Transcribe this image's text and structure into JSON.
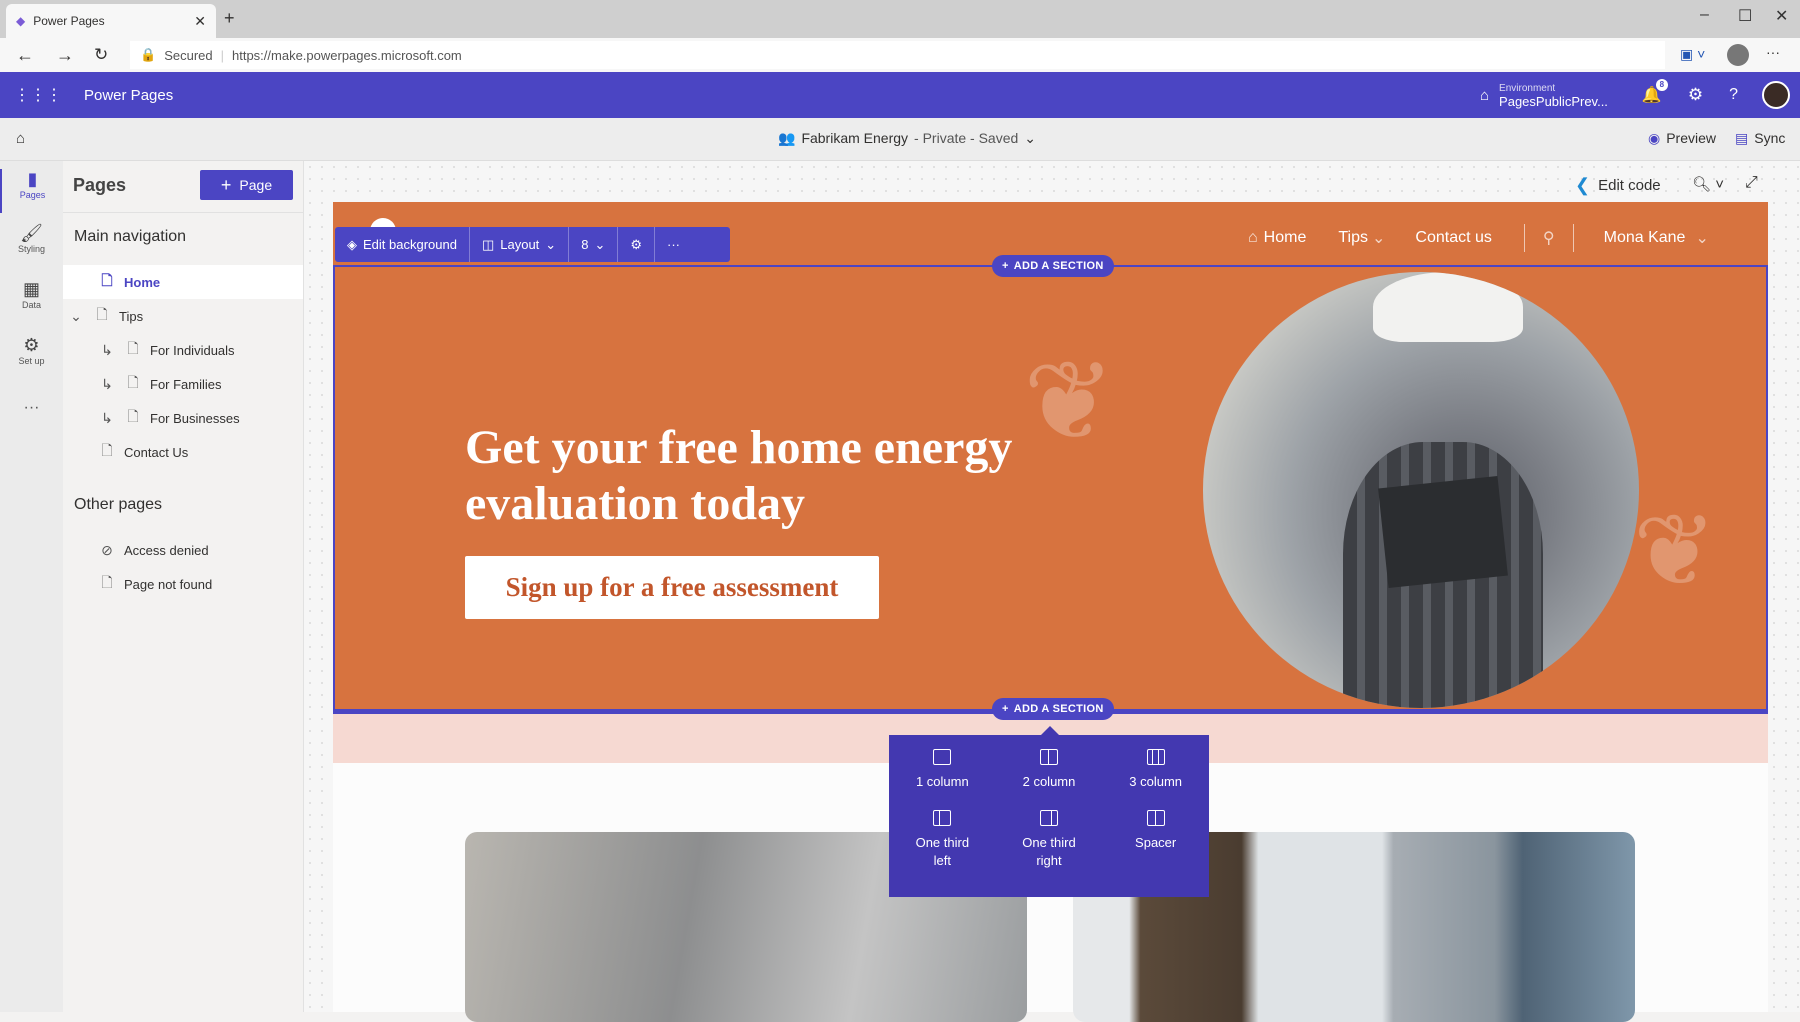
{
  "browser": {
    "tab_title": "Power Pages",
    "secured": "Secured",
    "url": "https://make.powerpages.microsoft.com"
  },
  "header": {
    "app_name": "Power Pages",
    "env_label": "Environment",
    "env_name": "PagesPublicPrev...",
    "notif_count": "8"
  },
  "cmdbar": {
    "site": "Fabrikam Energy",
    "status": " - Private - Saved",
    "preview": "Preview",
    "sync": "Sync"
  },
  "rail": [
    {
      "label": "Pages"
    },
    {
      "label": "Styling"
    },
    {
      "label": "Data"
    },
    {
      "label": "Set up"
    }
  ],
  "panel": {
    "title": "Pages",
    "add_page": "Page",
    "main_nav_title": "Main navigation",
    "main_nav": [
      {
        "label": "Home"
      },
      {
        "label": "Tips"
      },
      {
        "label": "For Individuals"
      },
      {
        "label": "For Families"
      },
      {
        "label": "For Businesses"
      },
      {
        "label": "Contact Us"
      }
    ],
    "other_title": "Other pages",
    "other": [
      {
        "label": "Access denied"
      },
      {
        "label": "Page not found"
      }
    ]
  },
  "canvas": {
    "edit_code": "Edit code",
    "toolbar": {
      "edit_background": "Edit background",
      "layout": "Layout"
    },
    "add_section": "ADD A SECTION",
    "site_nav": {
      "home": "Home",
      "tips": "Tips",
      "contact": "Contact us",
      "user": "Mona Kane"
    },
    "hero": {
      "heading": "Get your free home energy evaluation today",
      "cta": "Sign up for a free assessment"
    },
    "section_options": [
      {
        "label": "1 column"
      },
      {
        "label": "2 column"
      },
      {
        "label": "3 column"
      },
      {
        "label": "One third left"
      },
      {
        "label": "One third right"
      },
      {
        "label": "Spacer"
      }
    ]
  },
  "colors": {
    "brand": "#4b45c3",
    "hero": "#d7733f",
    "popup": "#4338b0"
  }
}
